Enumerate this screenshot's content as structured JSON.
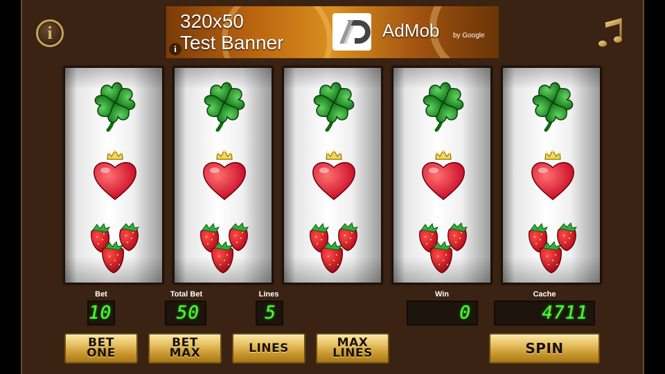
{
  "colors": {
    "frame": "#3a2313",
    "display_text": "#4bff3a",
    "button_gold": "#e8c264"
  },
  "top_bar": {
    "info_icon": "info-icon",
    "info_label": "i",
    "music_icon": "music-note-icon"
  },
  "ad": {
    "line1": "320x50",
    "line2": "Test Banner",
    "brand": "AdMob",
    "by": "by Google",
    "info_glyph": "i"
  },
  "reels": [
    {
      "symbols": [
        "clover",
        "crowned-heart",
        "strawberries"
      ]
    },
    {
      "symbols": [
        "clover",
        "crowned-heart",
        "strawberries"
      ]
    },
    {
      "symbols": [
        "clover",
        "crowned-heart",
        "strawberries"
      ]
    },
    {
      "symbols": [
        "clover",
        "crowned-heart",
        "strawberries"
      ]
    },
    {
      "symbols": [
        "clover",
        "crowned-heart",
        "strawberries"
      ]
    }
  ],
  "stats": {
    "bet_label": "Bet",
    "bet_value": "10",
    "total_bet_label": "Total Bet",
    "total_bet_value": "50",
    "lines_label": "Lines",
    "lines_value": "5",
    "win_label": "Win",
    "win_value": "0",
    "cache_label": "Cache",
    "cache_value": "4711"
  },
  "buttons": {
    "bet_one": "BET\nONE",
    "bet_max": "BET\nMAX",
    "lines": "LINES",
    "max_lines": "MAX\nLINES",
    "spin": "SPIN"
  }
}
